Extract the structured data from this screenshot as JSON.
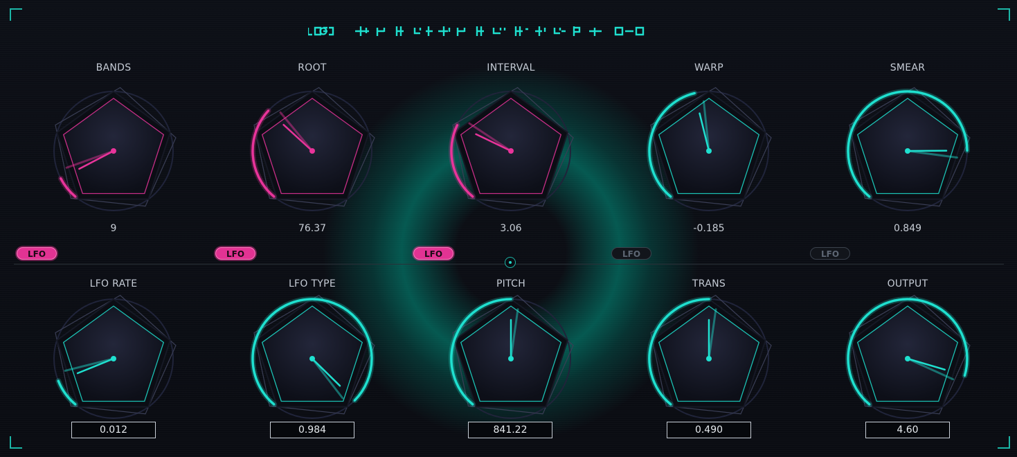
{
  "colors": {
    "pink": "#e8349a",
    "teal": "#1fe0cf",
    "background": "#0a0c12"
  },
  "title_icon": "alien-glyph-title-logo",
  "knobs_top": [
    {
      "label": "BANDS",
      "value": "9",
      "accent": "pink",
      "level": 0.08,
      "lfo": {
        "label": "LFO",
        "active": true
      }
    },
    {
      "label": "ROOT",
      "value": "76.37",
      "accent": "pink",
      "level": 0.33,
      "lfo": {
        "label": "LFO",
        "active": true
      }
    },
    {
      "label": "INTERVAL",
      "value": "3.06",
      "accent": "pink",
      "level": 0.27,
      "lfo": {
        "label": "LFO",
        "active": true
      }
    },
    {
      "label": "WARP",
      "value": "-0.185",
      "accent": "teal",
      "level": 0.45,
      "lfo": {
        "label": "LFO",
        "active": false
      }
    },
    {
      "label": "SMEAR",
      "value": "0.849",
      "accent": "teal",
      "level": 0.82,
      "lfo": {
        "label": "LFO",
        "active": false
      }
    }
  ],
  "knobs_bottom": [
    {
      "label": "LFO RATE",
      "value": "0.012",
      "accent": "teal",
      "level": 0.1
    },
    {
      "label": "LFO TYPE",
      "value": "0.984",
      "accent": "teal",
      "level": 0.98
    },
    {
      "label": "PITCH",
      "value": "841.22",
      "accent": "teal",
      "level": 0.5
    },
    {
      "label": "TRANS",
      "value": "0.490",
      "accent": "teal",
      "level": 0.5
    },
    {
      "label": "OUTPUT",
      "value": "4.60",
      "accent": "teal",
      "level": 0.88
    }
  ]
}
